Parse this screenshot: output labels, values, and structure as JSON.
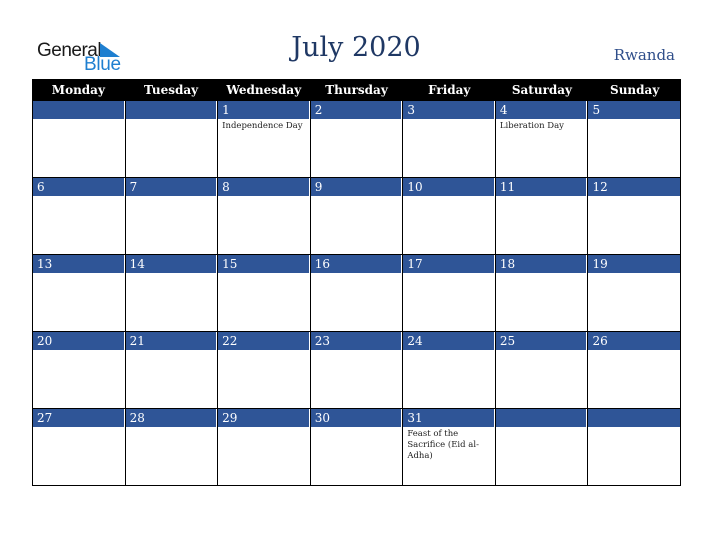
{
  "logo": {
    "word1": "General",
    "word2": "Blue"
  },
  "title": "July 2020",
  "country": "Rwanda",
  "days": [
    "Monday",
    "Tuesday",
    "Wednesday",
    "Thursday",
    "Friday",
    "Saturday",
    "Sunday"
  ],
  "weeks": [
    [
      {
        "d": "",
        "e": ""
      },
      {
        "d": "",
        "e": ""
      },
      {
        "d": "1",
        "e": "Independence Day"
      },
      {
        "d": "2",
        "e": ""
      },
      {
        "d": "3",
        "e": ""
      },
      {
        "d": "4",
        "e": "Liberation Day"
      },
      {
        "d": "5",
        "e": ""
      }
    ],
    [
      {
        "d": "6",
        "e": ""
      },
      {
        "d": "7",
        "e": ""
      },
      {
        "d": "8",
        "e": ""
      },
      {
        "d": "9",
        "e": ""
      },
      {
        "d": "10",
        "e": ""
      },
      {
        "d": "11",
        "e": ""
      },
      {
        "d": "12",
        "e": ""
      }
    ],
    [
      {
        "d": "13",
        "e": ""
      },
      {
        "d": "14",
        "e": ""
      },
      {
        "d": "15",
        "e": ""
      },
      {
        "d": "16",
        "e": ""
      },
      {
        "d": "17",
        "e": ""
      },
      {
        "d": "18",
        "e": ""
      },
      {
        "d": "19",
        "e": ""
      }
    ],
    [
      {
        "d": "20",
        "e": ""
      },
      {
        "d": "21",
        "e": ""
      },
      {
        "d": "22",
        "e": ""
      },
      {
        "d": "23",
        "e": ""
      },
      {
        "d": "24",
        "e": ""
      },
      {
        "d": "25",
        "e": ""
      },
      {
        "d": "26",
        "e": ""
      }
    ],
    [
      {
        "d": "27",
        "e": ""
      },
      {
        "d": "28",
        "e": ""
      },
      {
        "d": "29",
        "e": ""
      },
      {
        "d": "30",
        "e": ""
      },
      {
        "d": "31",
        "e": "Feast of the Sacrifice (Eid al-Adha)"
      },
      {
        "d": "",
        "e": ""
      },
      {
        "d": "",
        "e": ""
      }
    ]
  ]
}
